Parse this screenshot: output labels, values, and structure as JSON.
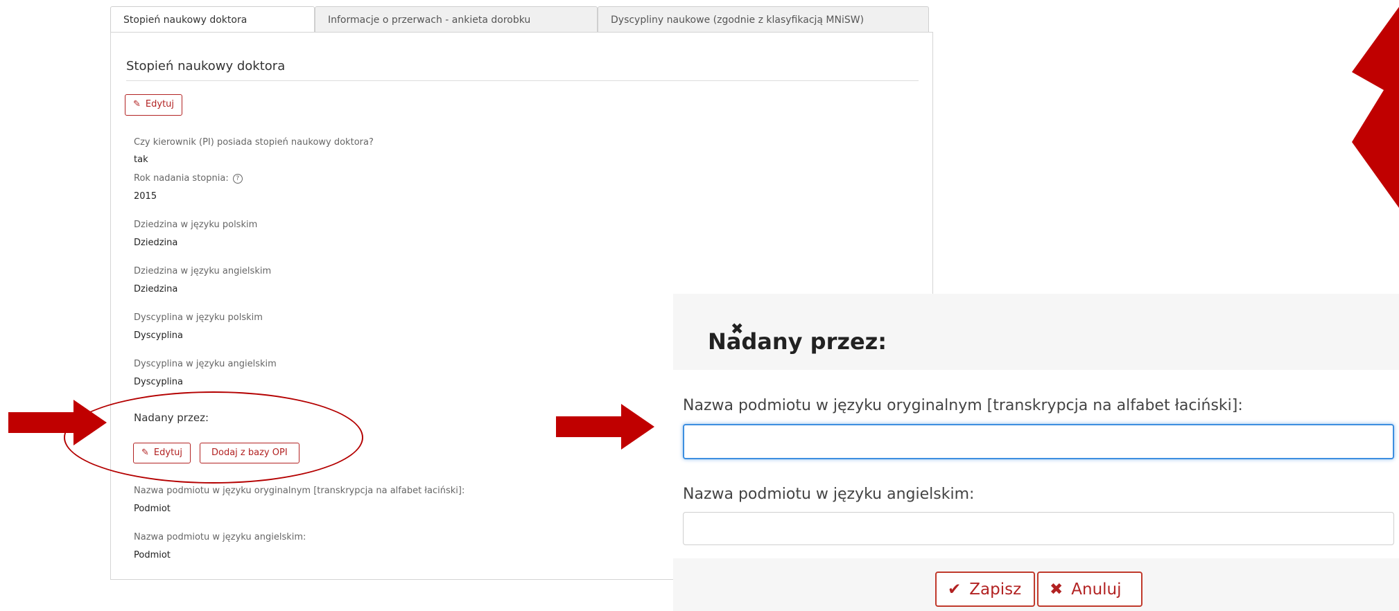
{
  "tabs": [
    {
      "label": "Stopień naukowy doktora",
      "active": true
    },
    {
      "label": "Informacje o przerwach - ankieta dorobku",
      "active": false
    },
    {
      "label": "Dyscypliny naukowe (zgodnie z klasyfikacją MNiSW)",
      "active": false
    }
  ],
  "panel": {
    "title": "Stopień naukowy doktora",
    "edit_label": "Edytuj",
    "fields": [
      {
        "label": "Czy kierownik (PI) posiada stopień naukowy doktora?",
        "value": "tak"
      },
      {
        "label": "Rok nadania stopnia:",
        "value": "2015"
      },
      {
        "label": "Dziedzina w języku polskim",
        "value": "Dziedzina"
      },
      {
        "label": "Dziedzina w języku angielskim",
        "value": "Dziedzina"
      },
      {
        "label": "Dyscyplina w języku polskim",
        "value": "Dyscyplina"
      },
      {
        "label": "Dyscyplina w języku angielskim",
        "value": "Dyscyplina"
      }
    ],
    "granted_section": {
      "title": "Nadany przez:",
      "edit_label": "Edytuj",
      "add_opi_label": "Dodaj z bazy OPI",
      "fields": [
        {
          "label": "Nazwa podmiotu w języku oryginalnym [transkrypcja na alfabet łaciński]:",
          "value": "Podmiot"
        },
        {
          "label": "Nazwa podmiotu w języku angielskim:",
          "value": "Podmiot"
        }
      ]
    }
  },
  "modal": {
    "title": "Nadany przez:",
    "close_icon": "close-icon",
    "fields": [
      {
        "label": "Nazwa podmiotu w języku oryginalnym [transkrypcja na alfabet łaciński]:",
        "value": ""
      },
      {
        "label": "Nazwa podmiotu w języku angielskim:",
        "value": ""
      }
    ],
    "save_label": "Zapisz",
    "cancel_label": "Anuluj"
  },
  "colors": {
    "accent_red": "#b22222",
    "arrow_red": "#c00000",
    "focus_blue": "#3c8ee0"
  }
}
